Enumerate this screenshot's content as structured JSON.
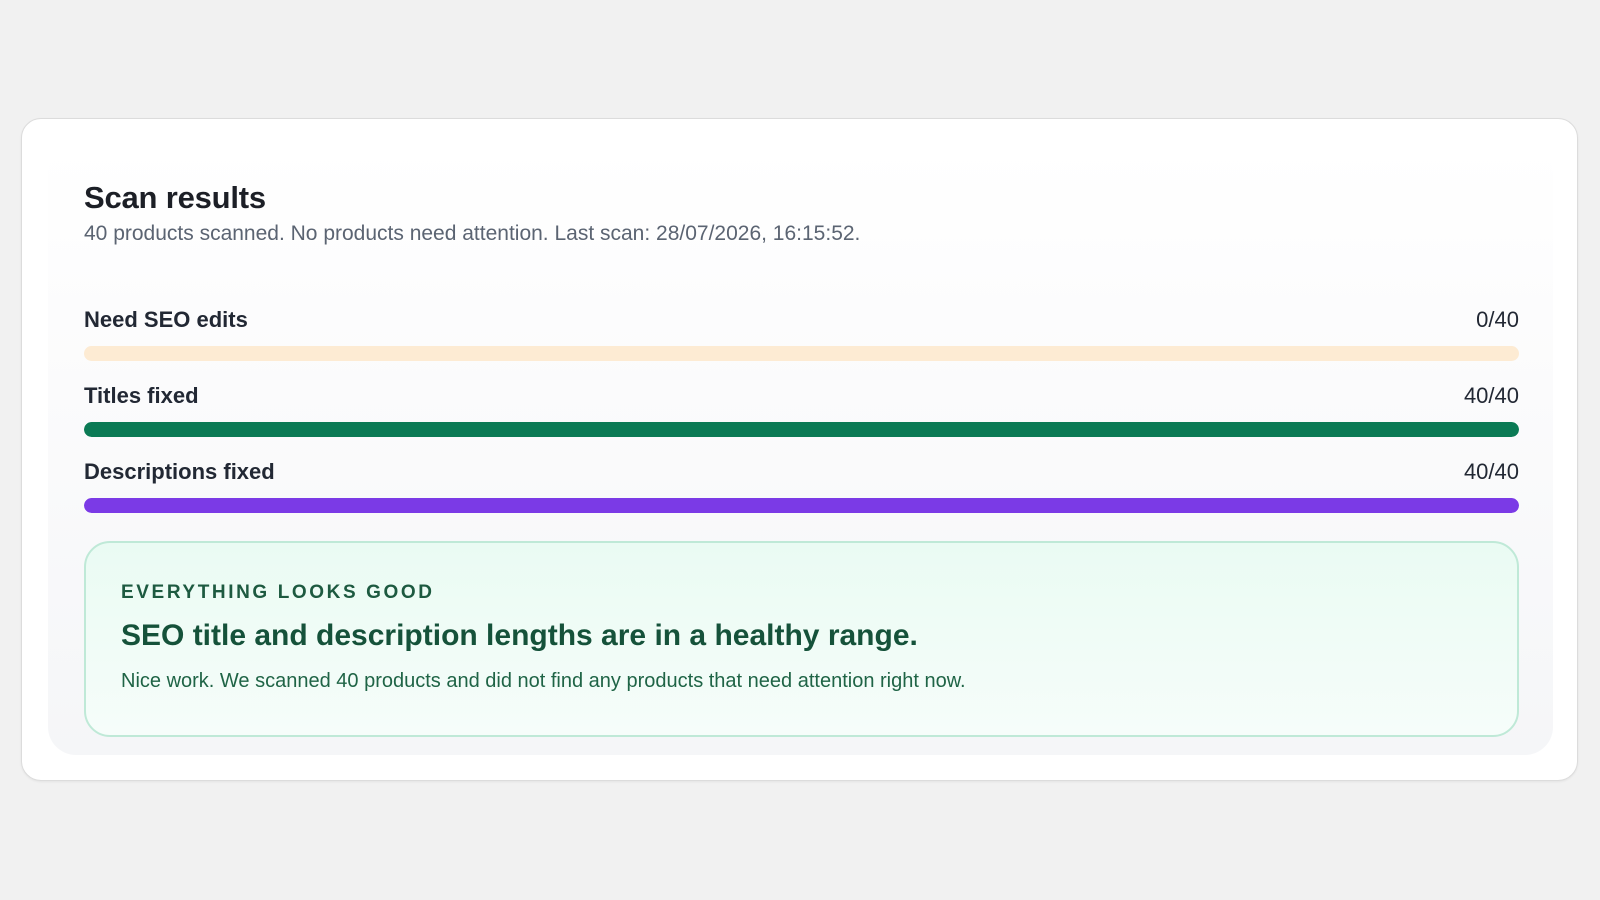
{
  "scan": {
    "title": "Scan results",
    "summary": "40 products scanned. No products need attention. Last scan: 28/07/2026, 16:15:52."
  },
  "metrics": [
    {
      "label": "Need SEO edits",
      "value_text": "0/40",
      "progress": 0.0,
      "track_color": "#fdebd3",
      "fill_color": "#f2b766"
    },
    {
      "label": "Titles fixed",
      "value_text": "40/40",
      "progress": 1.0,
      "track_color": "#d6efe4",
      "fill_color": "#0b7a55"
    },
    {
      "label": "Descriptions fixed",
      "value_text": "40/40",
      "progress": 1.0,
      "track_color": "#e6dcfb",
      "fill_color": "#7b3ae6"
    }
  ],
  "callout": {
    "eyebrow": "EVERYTHING LOOKS GOOD",
    "heading": "SEO title and description lengths are in a healthy range.",
    "body": "Nice work. We scanned 40 products and did not find any products that need attention right now."
  },
  "colors": {
    "page_background": "#f1f1f1",
    "card_background": "#ffffff",
    "success_text": "#15523a",
    "success_border": "#bfe9d7",
    "success_background": "#eafbf3"
  }
}
